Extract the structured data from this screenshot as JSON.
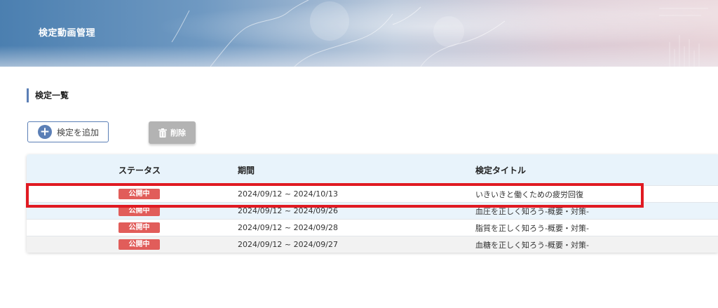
{
  "header": {
    "title": "検定動画管理"
  },
  "section": {
    "title": "検定一覧"
  },
  "toolbar": {
    "add_label": "検定を追加",
    "add_icon": "plus-circle-icon",
    "delete_label": "削除",
    "delete_icon": "trash-icon"
  },
  "table": {
    "columns": [
      "ステータス",
      "期間",
      "検定タイトル"
    ],
    "rows": [
      {
        "status": "公開中",
        "period": "2024/09/12 ~ 2024/10/13",
        "title": "いきいきと働くための疲労回復"
      },
      {
        "status": "公開中",
        "period": "2024/09/12 ~ 2024/09/26",
        "title": "血圧を正しく知ろう-概要・対策-"
      },
      {
        "status": "公開中",
        "period": "2024/09/12 ~ 2024/09/28",
        "title": "脂質を正しく知ろう-概要・対策-"
      },
      {
        "status": "公開中",
        "period": "2024/09/12 ~ 2024/09/27",
        "title": "血糖を正しく知ろう-概要・対策-"
      }
    ]
  },
  "colors": {
    "accent": "#5b7fb6",
    "status_badge": "#e15d5a",
    "highlight": "#e01a22",
    "header_row": "#e8f3fb"
  }
}
